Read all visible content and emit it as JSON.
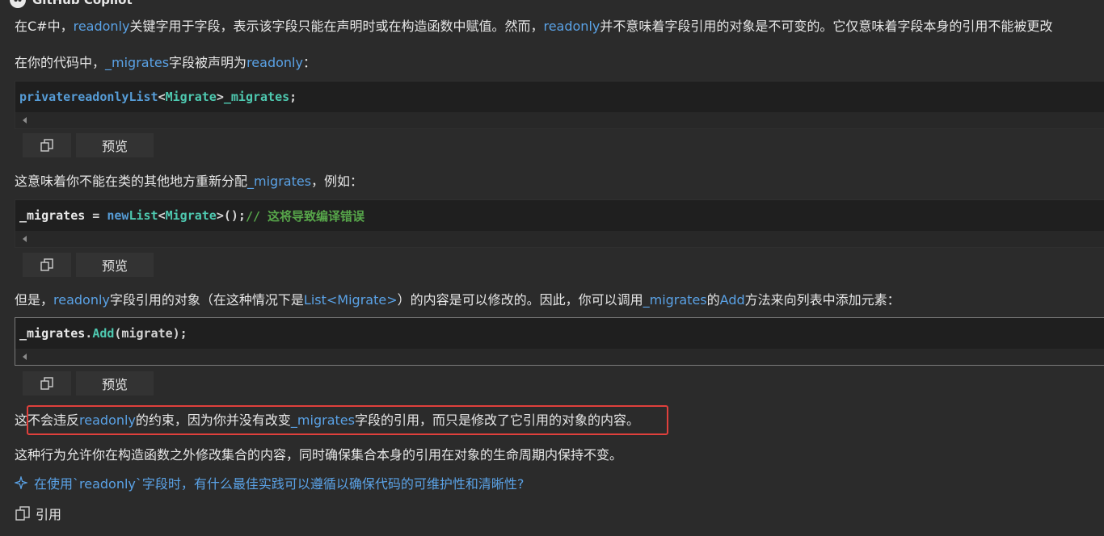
{
  "header": {
    "title": "GitHub Copilot"
  },
  "paragraphs": {
    "p1": {
      "a": "在C#中，",
      "kw1": "readonly",
      "b": "关键字用于字段，表示该字段只能在声明时或在构造函数中赋值。然而，",
      "kw2": "readonly",
      "c": "并不意味着字段引用的对象是不可变的。它仅意味着字段本身的引用不能被更改"
    },
    "p2": {
      "a": "在你的代码中，",
      "field": "_migrates",
      "b": "字段被声明为",
      "kw": "readonly",
      "c": "："
    },
    "p3": {
      "a": "这意味着你不能在类的其他地方重新分配",
      "field": "_migrates",
      "b": "，例如："
    },
    "p4": {
      "a": "但是，",
      "kw": "readonly",
      "b": "字段引用的对象（在这种情况下是",
      "type": "List<Migrate>",
      "c": "）的内容是可以修改的。因此，你可以调用",
      "field": "_migrates",
      "d": "的",
      "method": "Add",
      "e": "方法来向列表中添加元素："
    },
    "p5": {
      "a": "这",
      "b": "不会违反",
      "kw": "readonly",
      "c": "的约束，因为你并没有改变",
      "field": "_migrates",
      "d": "字段的引用，而只是修改了它引用的对象的内容。"
    },
    "p6": {
      "text": "这种行为允许你在构造函数之外修改集合的内容，同时确保集合本身的引用在对象的生命周期内保持不变。"
    }
  },
  "code1": {
    "t1": "private",
    "t2": "readonly",
    "t3": "List",
    "t4": "<",
    "t5": "Migrate",
    "t6": ">",
    "t7": "_migrates",
    "t8": ";"
  },
  "code2": {
    "t1": "_migrates",
    "t2": " = ",
    "t3": "new",
    "t4": "List",
    "t5": "<",
    "t6": "Migrate",
    "t7": ">();",
    "t8": "// 这将导致编译错误"
  },
  "code3": {
    "t1": "_migrates",
    "t2": ".",
    "t3": "Add",
    "t4": "(migrate);"
  },
  "toolbar": {
    "preview_label": "预览"
  },
  "suggestion": {
    "text": "在使用`readonly`字段时，有什么最佳实践可以遵循以确保代码的可维护性和清晰性?"
  },
  "references": {
    "label": "引用"
  },
  "colors": {
    "background": "#2b2b2b",
    "code_background": "#1f1f1f",
    "link": "#5aa2e6",
    "keyword": "#569cd6",
    "type": "#4ec9b0",
    "comment": "#57a64a",
    "highlight_border": "#e0403c"
  },
  "icons": {
    "copy": "copy-icon",
    "sparkle": "sparkle-icon",
    "references": "references-icon",
    "logo": "copilot-logo-icon"
  }
}
